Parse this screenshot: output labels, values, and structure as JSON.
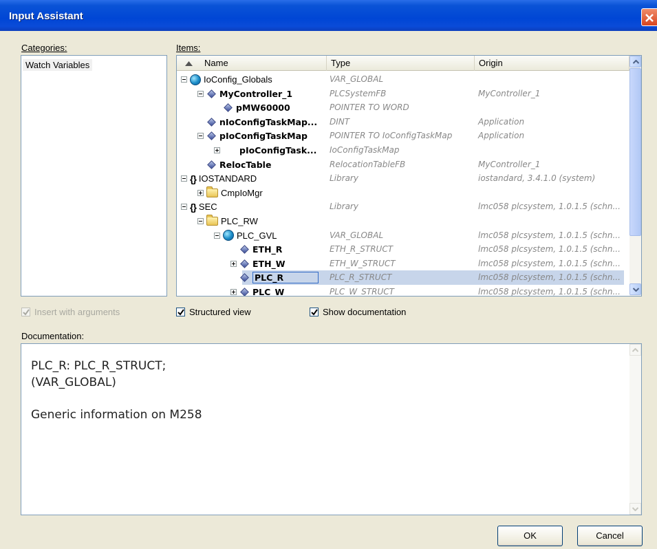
{
  "window": {
    "title": "Input Assistant"
  },
  "categories": {
    "label": "Categories:",
    "items": [
      "Watch Variables"
    ]
  },
  "items": {
    "label": "Items:",
    "columns": {
      "name": "Name",
      "type": "Type",
      "origin": "Origin"
    },
    "rows": [
      {
        "name": "IoConfig_Globals",
        "type": "VAR_GLOBAL",
        "origin": ""
      },
      {
        "name": "MyController_1",
        "type": "PLCSystemFB",
        "origin": "MyController_1"
      },
      {
        "name": "pMW60000",
        "type": "POINTER TO WORD",
        "origin": ""
      },
      {
        "name": "nIoConfigTaskMap...",
        "type": "DINT",
        "origin": "Application"
      },
      {
        "name": "pIoConfigTaskMap",
        "type": "POINTER TO IoConfigTaskMap",
        "origin": "Application"
      },
      {
        "name": "pIoConfigTask...",
        "type": "IoConfigTaskMap",
        "origin": ""
      },
      {
        "name": "RelocTable",
        "type": "RelocationTableFB",
        "origin": "MyController_1"
      },
      {
        "name": "IOSTANDARD",
        "type": "Library",
        "origin": "iostandard, 3.4.1.0 (system)"
      },
      {
        "name": "CmpIoMgr",
        "type": "",
        "origin": ""
      },
      {
        "name": "SEC",
        "type": "Library",
        "origin": "lmc058 plcsystem, 1.0.1.5 (schn..."
      },
      {
        "name": "PLC_RW",
        "type": "",
        "origin": ""
      },
      {
        "name": "PLC_GVL",
        "type": "VAR_GLOBAL",
        "origin": "lmc058 plcsystem, 1.0.1.5 (schn..."
      },
      {
        "name": "ETH_R",
        "type": "ETH_R_STRUCT",
        "origin": "lmc058 plcsystem, 1.0.1.5 (schn..."
      },
      {
        "name": "ETH_W",
        "type": "ETH_W_STRUCT",
        "origin": "lmc058 plcsystem, 1.0.1.5 (schn..."
      },
      {
        "name": "PLC_R",
        "type": "PLC_R_STRUCT",
        "origin": "lmc058 plcsystem, 1.0.1.5 (schn..."
      },
      {
        "name": "PLC_W",
        "type": "PLC_W_STRUCT",
        "origin": "lmc058 plcsystem, 1.0.1.5 (schn..."
      }
    ]
  },
  "options": {
    "insert_with_arguments": "Insert with arguments",
    "structured_view": "Structured view",
    "show_documentation": "Show documentation"
  },
  "documentation": {
    "label": "Documentation:",
    "line1": "PLC_R: PLC_R_STRUCT;",
    "line2": "(VAR_GLOBAL)",
    "line3": "Generic information on M258"
  },
  "buttons": {
    "ok": "OK",
    "cancel": "Cancel"
  },
  "colors": {
    "title_bar": "#0046d5",
    "selection": "#c7d5ea",
    "close": "#d7441f"
  }
}
